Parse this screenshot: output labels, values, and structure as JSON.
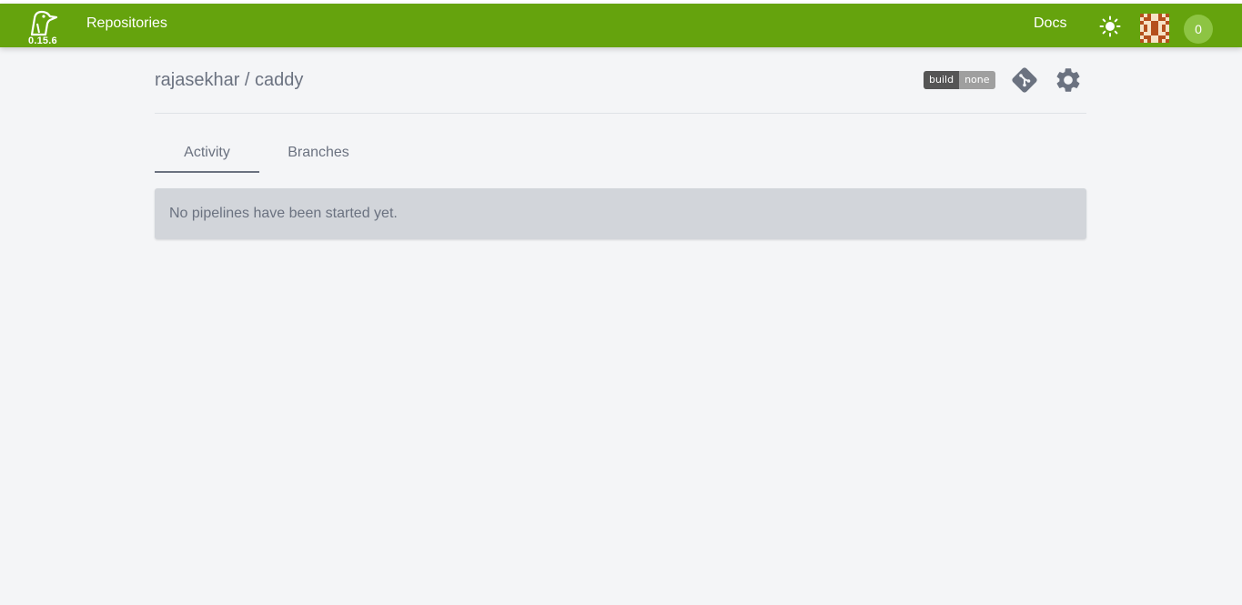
{
  "header": {
    "version": "0.15.6",
    "nav_repositories": "Repositories",
    "nav_docs": "Docs",
    "notification_count": "0",
    "logo_icon": "woodpecker-logo-icon",
    "theme_icon": "sun-icon",
    "accent_color": "#65a30d"
  },
  "repo": {
    "title": "rajasekhar / caddy",
    "badge_left": "build",
    "badge_right": "none",
    "git_icon": "git-icon",
    "settings_icon": "gear-icon"
  },
  "tabs": [
    {
      "label": "Activity",
      "active": true
    },
    {
      "label": "Branches",
      "active": false
    }
  ],
  "notice": {
    "text": "No pipelines have been started yet."
  }
}
